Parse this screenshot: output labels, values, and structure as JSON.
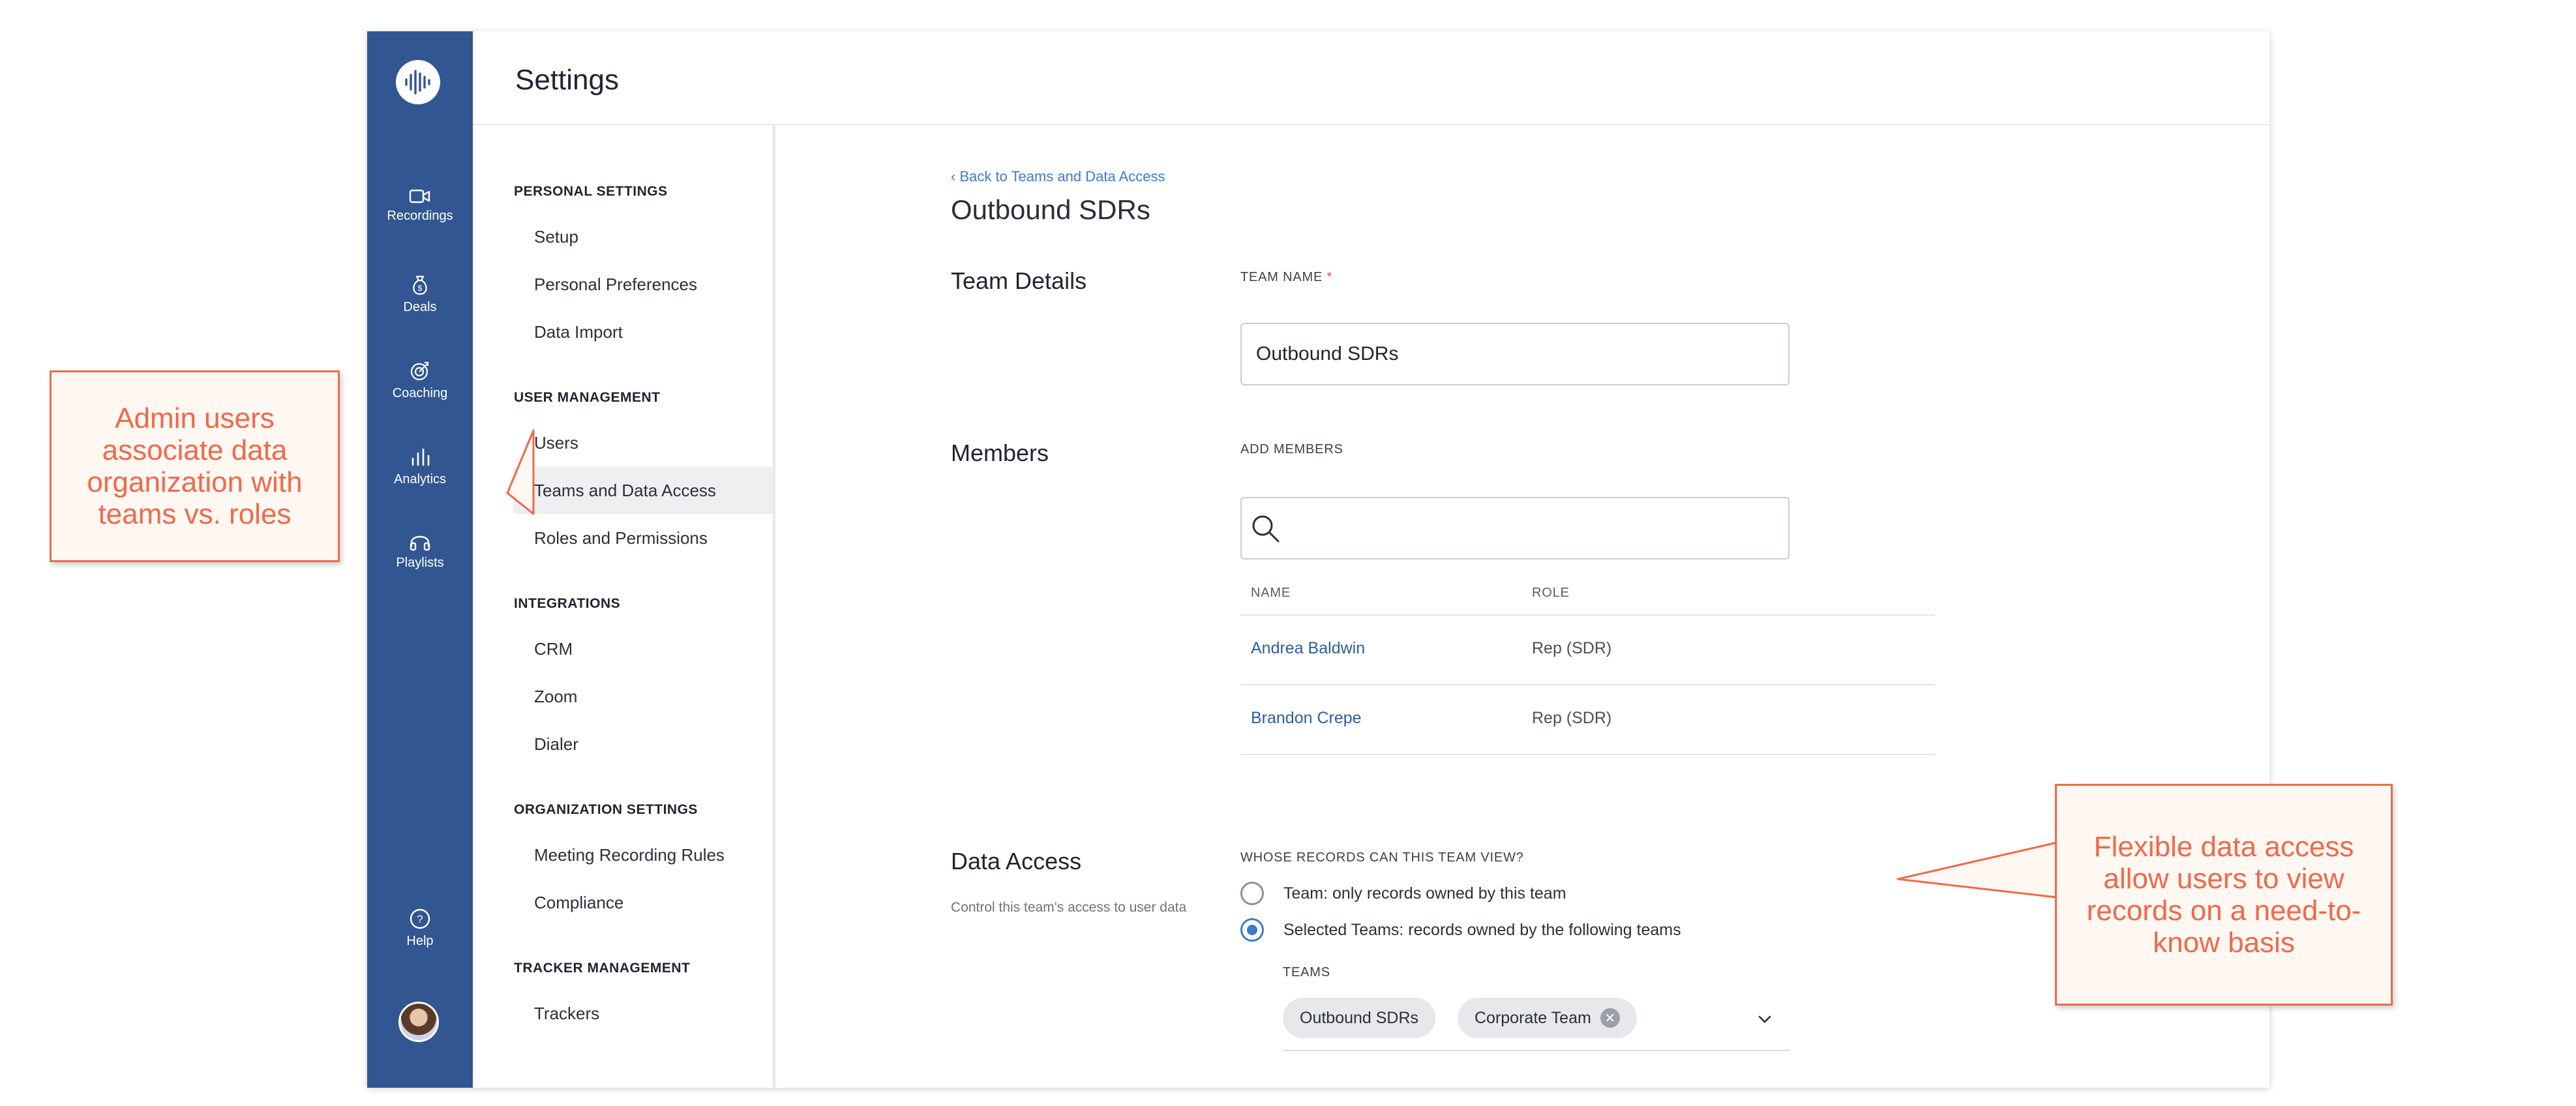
{
  "rail": {
    "items": [
      {
        "label": "Recordings",
        "icon": "video-camera-icon"
      },
      {
        "label": "Deals",
        "icon": "money-bag-icon"
      },
      {
        "label": "Coaching",
        "icon": "target-icon"
      },
      {
        "label": "Analytics",
        "icon": "chart-icon"
      },
      {
        "label": "Playlists",
        "icon": "headphones-icon"
      }
    ],
    "help_label": "Help"
  },
  "header": {
    "title": "Settings"
  },
  "sidebar": {
    "personal_settings": {
      "heading": "PERSONAL SETTINGS",
      "items": [
        "Setup",
        "Personal Preferences",
        "Data Import"
      ]
    },
    "user_management": {
      "heading": "USER MANAGEMENT",
      "items": [
        "Users",
        "Teams and Data Access",
        "Roles and Permissions"
      ]
    },
    "integrations": {
      "heading": "INTEGRATIONS",
      "items": [
        "CRM",
        "Zoom",
        "Dialer"
      ]
    },
    "organization_settings": {
      "heading": "ORGANIZATION SETTINGS",
      "items": [
        "Meeting Recording Rules",
        "Compliance"
      ]
    },
    "tracker_management": {
      "heading": "TRACKER MANAGEMENT",
      "items": [
        "Trackers"
      ]
    },
    "active_item": "Teams and Data Access"
  },
  "main": {
    "back_link": "Back to Teams and Data Access",
    "page_title": "Outbound SDRs",
    "team_details": {
      "title": "Team Details",
      "field_label": "TEAM NAME",
      "required_mark": "*",
      "value": "Outbound SDRs"
    },
    "members": {
      "title": "Members",
      "add_label": "ADD MEMBERS",
      "search_placeholder": "",
      "columns": [
        "NAME",
        "ROLE"
      ],
      "rows": [
        {
          "name": "Andrea Baldwin",
          "role": "Rep (SDR)"
        },
        {
          "name": "Brandon Crepe",
          "role": "Rep (SDR)"
        }
      ]
    },
    "data_access": {
      "title": "Data Access",
      "description": "Control this team's access to user data",
      "question": "WHOSE RECORDS CAN THIS TEAM VIEW?",
      "options": [
        {
          "label": "Team: only records owned by this team",
          "checked": false
        },
        {
          "label": "Selected Teams: records owned by the following teams",
          "checked": true
        }
      ],
      "teams_label": "TEAMS",
      "teams": [
        "Outbound SDRs",
        "Corporate Team"
      ]
    }
  },
  "callouts": {
    "left": "Admin users associate data organization with teams vs. roles",
    "right": "Flexible data access allow users to view records on a need-to-know basis"
  },
  "colors": {
    "rail": "#325691",
    "accent": "#3b7bd0",
    "callout": "#f0694a"
  }
}
